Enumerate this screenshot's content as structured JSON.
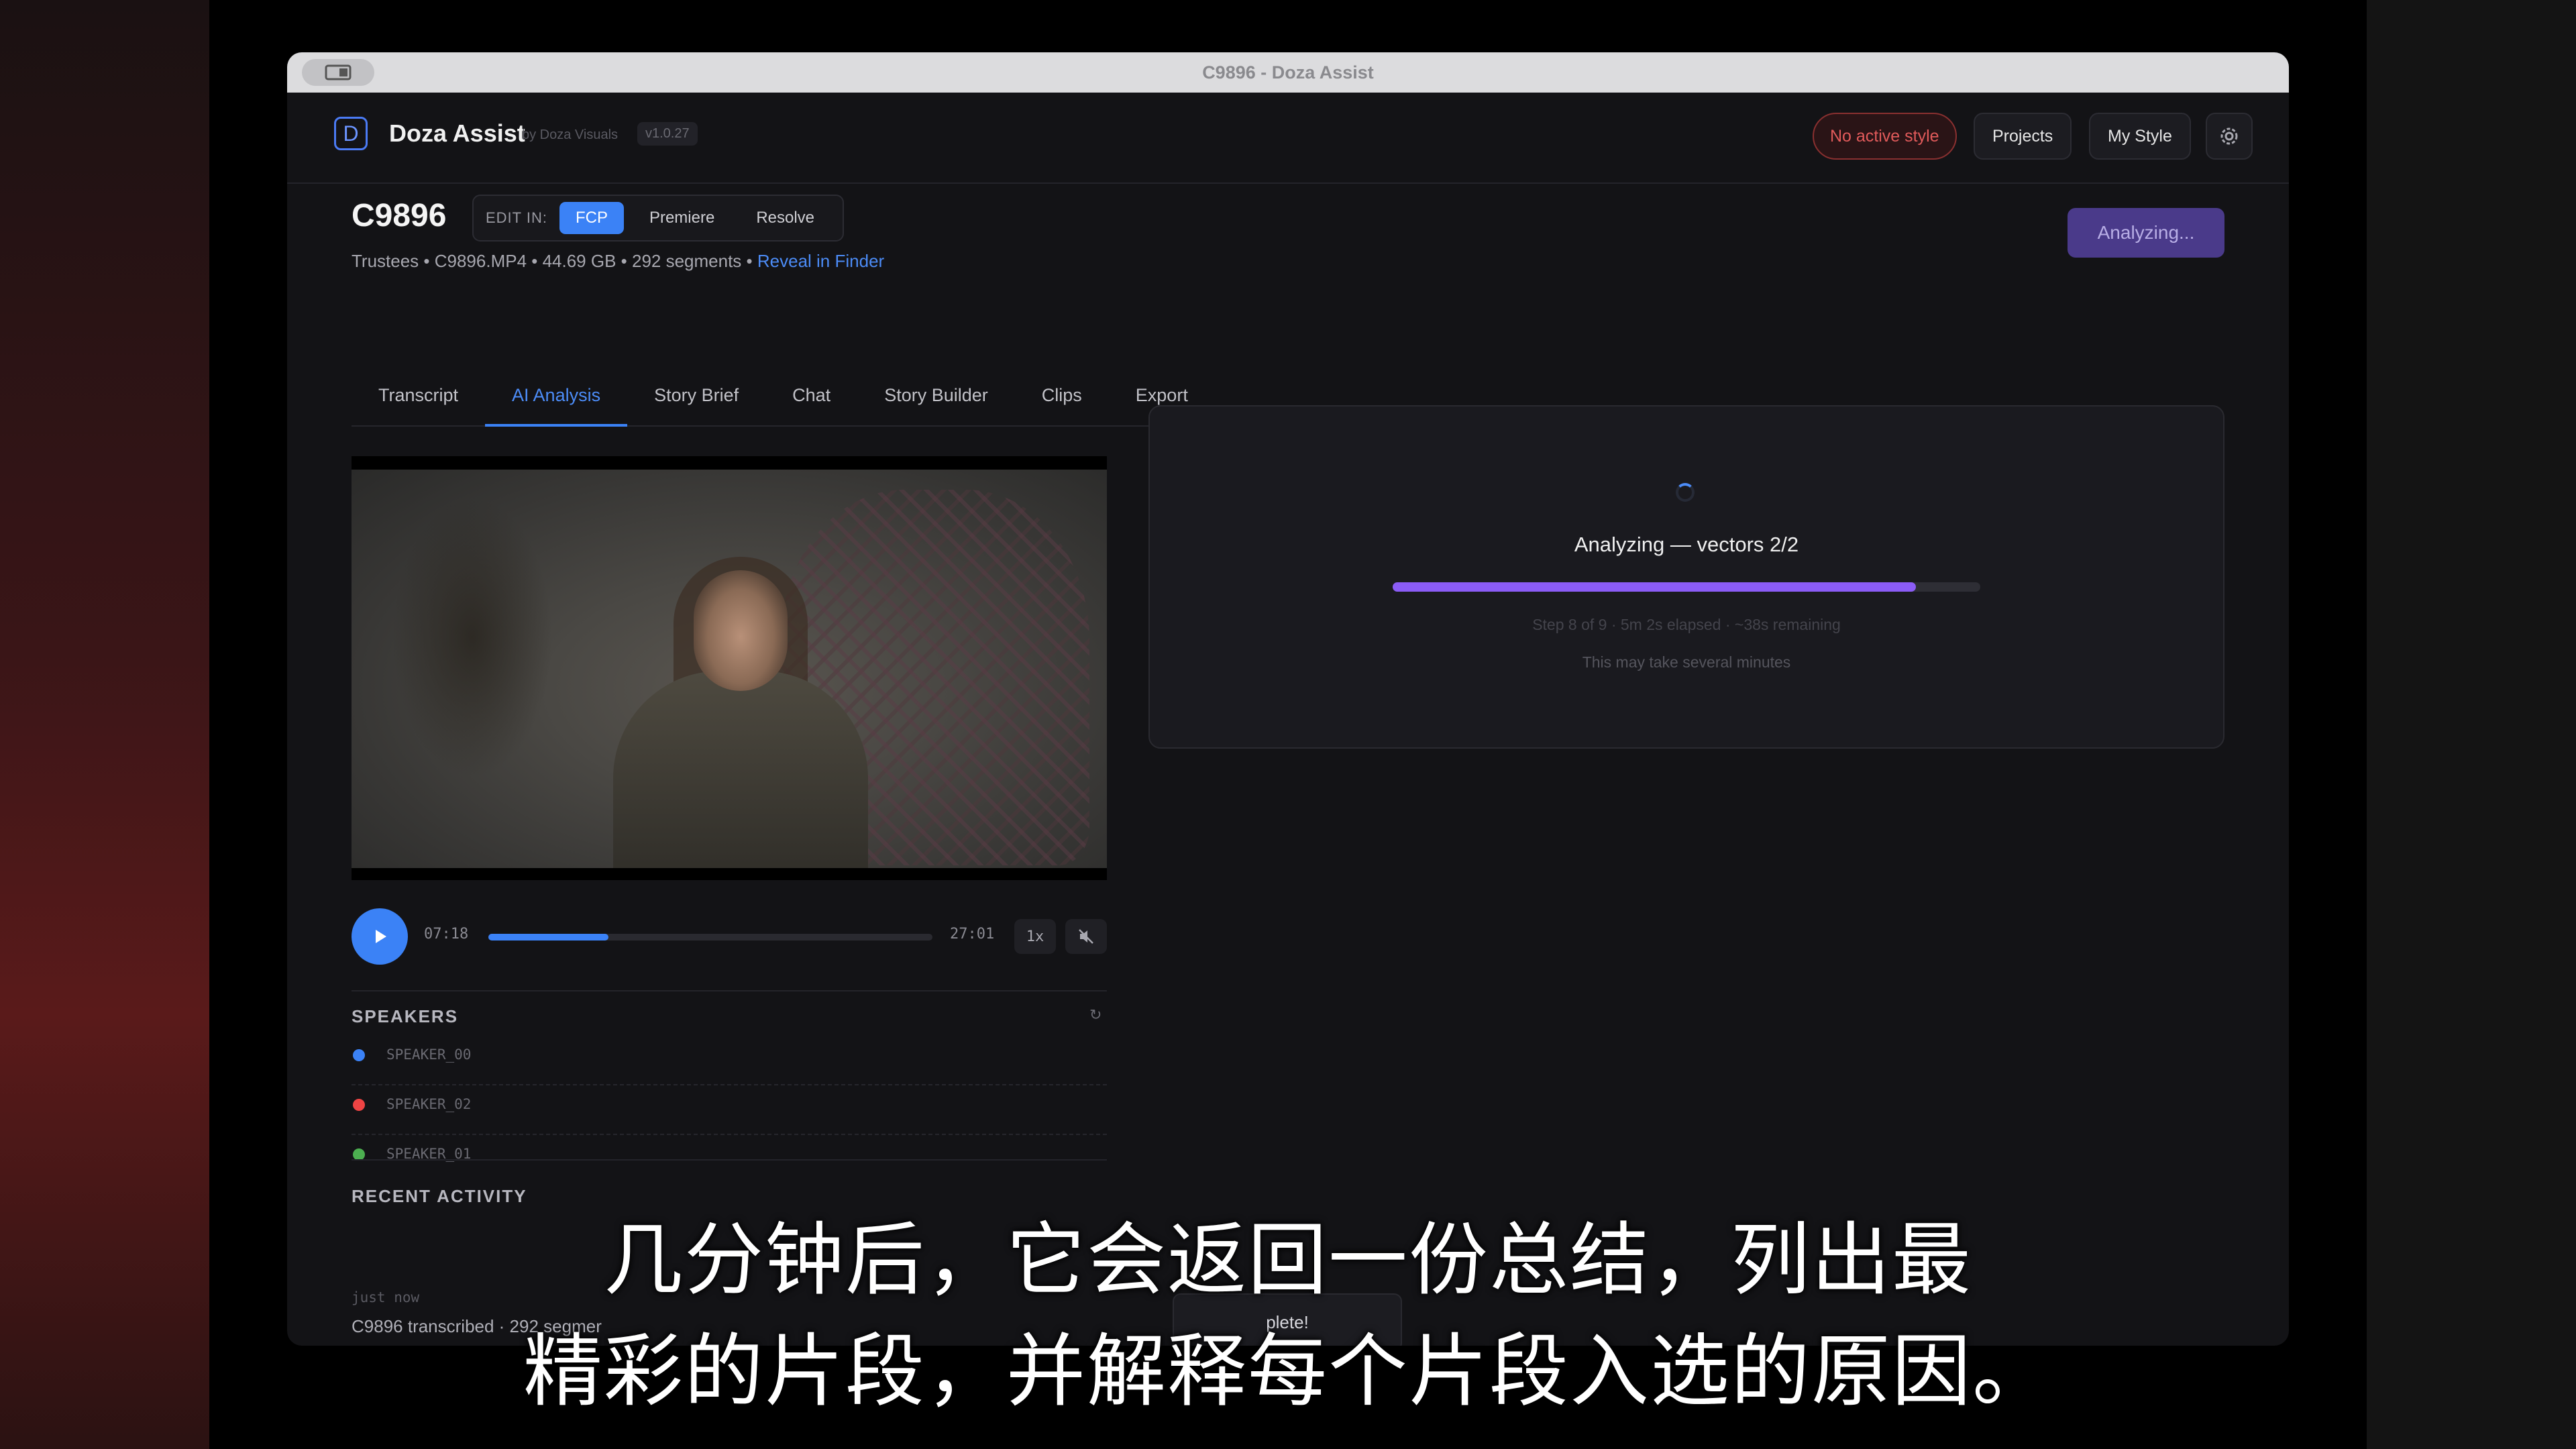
{
  "window": {
    "title": "C9896 - Doza Assist"
  },
  "app": {
    "logo_letter": "D",
    "name": "Doza Assist",
    "by": "by Doza Visuals",
    "version": "v1.0.27",
    "style_button": "No active style",
    "projects_button": "Projects",
    "my_style_button": "My Style"
  },
  "clip": {
    "title": "C9896",
    "edit_in_label": "EDIT IN:",
    "edit_options": [
      "FCP",
      "Premiere",
      "Resolve"
    ],
    "edit_selected": "FCP",
    "meta": "Trustees • C9896.MP4 • 44.69 GB • 292 segments •",
    "reveal_link": "Reveal in Finder",
    "status_button": "Analyzing..."
  },
  "tabs": [
    "Transcript",
    "AI Analysis",
    "Story Brief",
    "Chat",
    "Story Builder",
    "Clips",
    "Export"
  ],
  "active_tab": "AI Analysis",
  "player": {
    "current_time": "07:18",
    "total_time": "27:01",
    "speed": "1x",
    "progress": 0.27
  },
  "speakers": {
    "heading": "SPEAKERS",
    "items": [
      {
        "name": "SPEAKER_00",
        "color": "#3b82f6"
      },
      {
        "name": "SPEAKER_02",
        "color": "#ef4444"
      },
      {
        "name": "SPEAKER_01",
        "color": "#4caf50"
      }
    ]
  },
  "recent_activity": {
    "heading": "RECENT ACTIVITY",
    "time": "just now",
    "text": "C9896 transcribed · 292 segmer"
  },
  "toast": {
    "text": "plete!"
  },
  "analysis": {
    "title": "Analyzing — vectors 2/2",
    "progress": 0.89,
    "step": "Step 8 of 9 · 5m 2s elapsed · ~38s remaining",
    "note": "This may take several minutes",
    "accent": "#8b5cf6"
  },
  "subtitles": [
    "几分钟后，它会返回一份总结，列出最",
    "精彩的片段，并解释每个片段入选的原因。"
  ]
}
